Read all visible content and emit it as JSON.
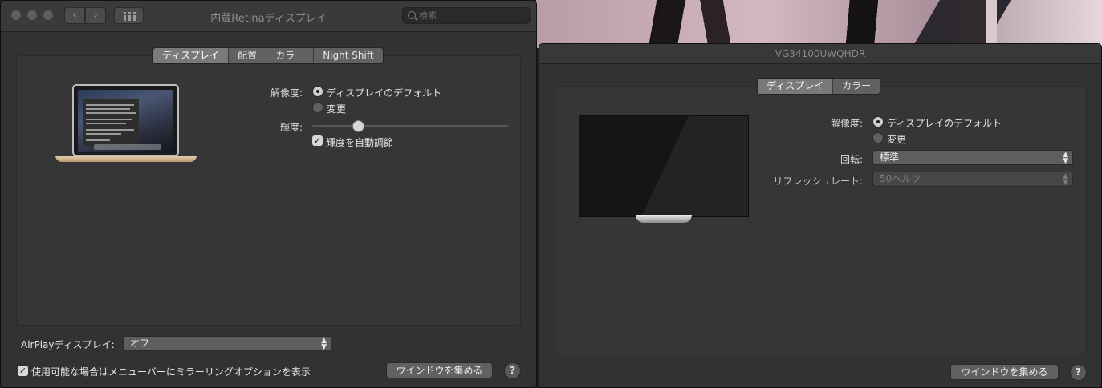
{
  "window1": {
    "title": "内蔵Retinaディスプレイ",
    "search_placeholder": "検索",
    "nav_back": "‹",
    "nav_forward": "›",
    "tabs": [
      {
        "label": "ディスプレイ",
        "selected": true
      },
      {
        "label": "配置",
        "selected": false
      },
      {
        "label": "カラー",
        "selected": false
      },
      {
        "label": "Night Shift",
        "selected": false
      }
    ],
    "resolution_label": "解像度:",
    "resolution_default": "ディスプレイのデフォルト",
    "resolution_scaled": "変更",
    "brightness_label": "輝度:",
    "brightness_level": 0.22,
    "auto_brightness": "輝度を自動調節",
    "airplay_label": "AirPlayディスプレイ:",
    "airplay_value": "オフ",
    "mirroring_option": "使用可能な場合はメニューバーにミラーリングオプションを表示",
    "gather_windows": "ウインドウを集める",
    "help": "?"
  },
  "window2": {
    "title": "VG34100UWQHDR",
    "tabs": [
      {
        "label": "ディスプレイ",
        "selected": true
      },
      {
        "label": "カラー",
        "selected": false
      }
    ],
    "resolution_label": "解像度:",
    "resolution_default": "ディスプレイのデフォルト",
    "resolution_scaled": "変更",
    "rotation_label": "回転:",
    "rotation_value": "標準",
    "refresh_label": "リフレッシュレート:",
    "refresh_value": "50ヘルツ",
    "gather_windows": "ウインドウを集める",
    "help": "?"
  },
  "icons": [
    "close-icon",
    "minimize-icon",
    "zoom-icon",
    "chevron-left-icon",
    "chevron-right-icon",
    "grid-icon",
    "search-icon",
    "laptop-icon",
    "monitor-icon",
    "checkmark-icon",
    "updown-arrows-icon",
    "help-icon"
  ]
}
